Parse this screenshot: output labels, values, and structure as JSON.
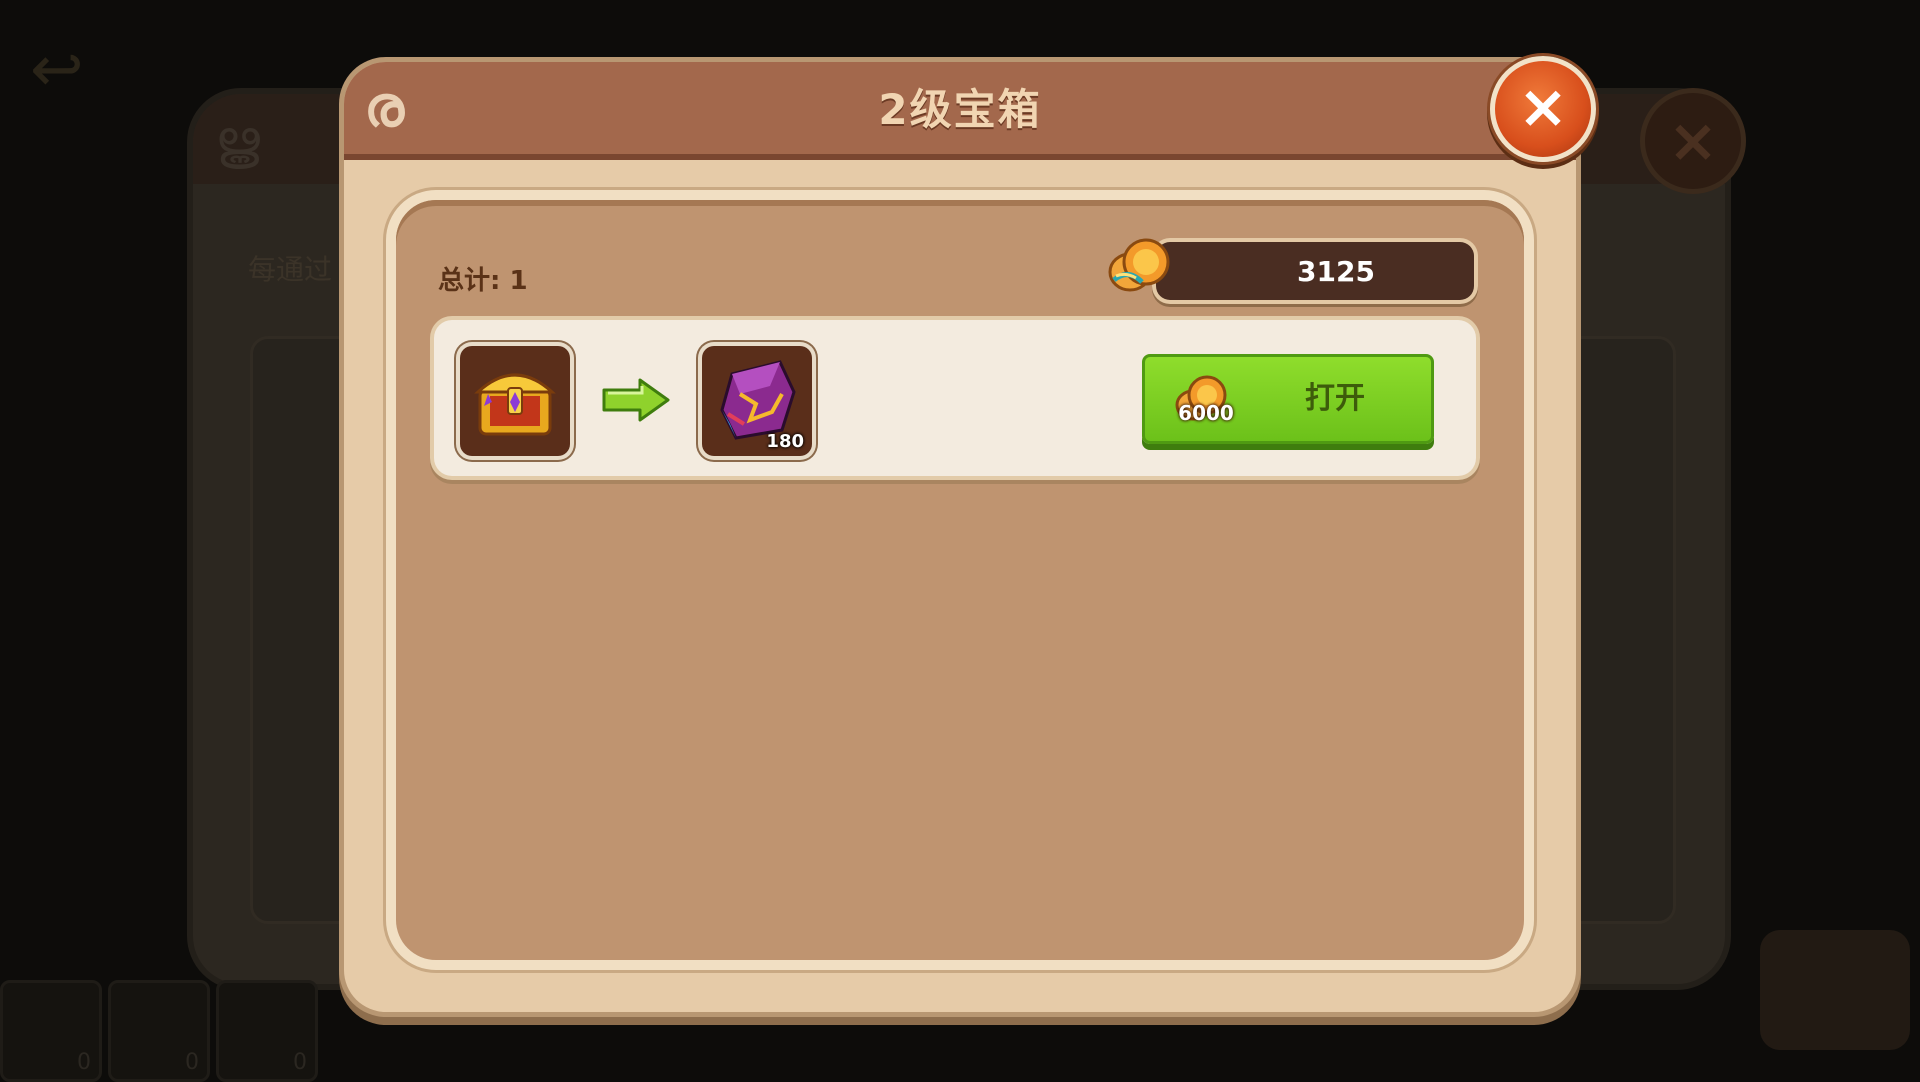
{
  "background": {
    "hint_text": "每通过",
    "slot_counts": [
      "0",
      "0",
      "0"
    ]
  },
  "dialog": {
    "title": "2级宝箱",
    "close_symbol": "×"
  },
  "summary": {
    "total_label": "总计: 1",
    "currency_value": "3125",
    "currency_icon": "gold-coins-icon"
  },
  "item": {
    "source_icon": "golden-treasure-chest-icon",
    "arrow_icon": "green-arrow-right-icon",
    "reward_icon": "purple-crystal-ore-icon",
    "reward_count": "180",
    "open_cost": "6000",
    "open_label": "打开"
  },
  "colors": {
    "title_bar": "#a3684c",
    "dialog_bg": "#e6cba8",
    "content_bg": "#bf9470",
    "button_green": "#7fd025",
    "close_orange": "#d84f1c"
  }
}
